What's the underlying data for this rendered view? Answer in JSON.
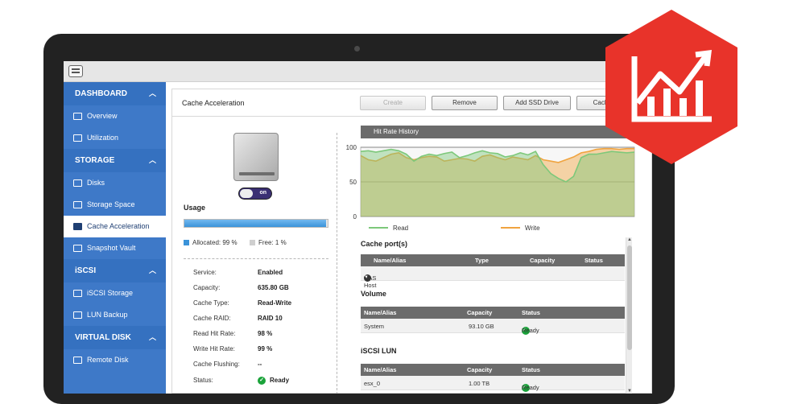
{
  "sidebar": {
    "sections": [
      {
        "label": "DASHBOARD",
        "items": [
          {
            "label": "Overview"
          },
          {
            "label": "Utilization"
          }
        ]
      },
      {
        "label": "STORAGE",
        "items": [
          {
            "label": "Disks"
          },
          {
            "label": "Storage Space"
          },
          {
            "label": "Cache Acceleration"
          },
          {
            "label": "Snapshot Vault"
          }
        ]
      },
      {
        "label": "iSCSI",
        "items": [
          {
            "label": "iSCSI Storage"
          },
          {
            "label": "LUN Backup"
          }
        ]
      },
      {
        "label": "VIRTUAL DISK",
        "items": [
          {
            "label": "Remote Disk"
          }
        ]
      }
    ]
  },
  "header": {
    "title": "Cache Acceleration",
    "buttons": {
      "create": "Create",
      "remove": "Remove",
      "add_ssd": "Add SSD Drive",
      "cache": "Cach"
    }
  },
  "left": {
    "toggle_label": "on",
    "usage_label": "Usage",
    "usage_percent": 99,
    "allocated_label": "Allocated: 99 %",
    "free_label": "Free: 1 %",
    "info": [
      {
        "key": "Service:",
        "value": "Enabled"
      },
      {
        "key": "Capacity:",
        "value": "635.80 GB"
      },
      {
        "key": "Cache Type:",
        "value": "Read-Write"
      },
      {
        "key": "Cache RAID:",
        "value": "RAID 10"
      },
      {
        "key": "Read Hit Rate:",
        "value": "98 %"
      },
      {
        "key": "Write Hit Rate:",
        "value": "99 %"
      },
      {
        "key": "Cache Flushing:",
        "value": "--"
      },
      {
        "key": "Status:",
        "value": "Ready"
      }
    ]
  },
  "chart": {
    "title": "Hit Rate History",
    "legend_read": "Read",
    "legend_write": "Write"
  },
  "chart_data": {
    "type": "area",
    "title": "Hit Rate History",
    "ylim": [
      0,
      100
    ],
    "yticks": [
      0,
      50,
      100
    ],
    "colors": {
      "read": "#7dc87a",
      "write": "#f0a440"
    },
    "series": [
      {
        "name": "Read",
        "values": [
          94,
          95,
          93,
          95,
          97,
          95,
          90,
          80,
          87,
          90,
          88,
          91,
          93,
          85,
          88,
          92,
          95,
          92,
          91,
          86,
          88,
          92,
          89,
          94,
          75,
          62,
          55,
          50,
          58,
          85,
          90,
          90,
          92,
          94,
          93,
          92,
          93
        ]
      },
      {
        "name": "Write",
        "values": [
          88,
          82,
          80,
          85,
          90,
          92,
          85,
          82,
          85,
          87,
          86,
          80,
          82,
          84,
          83,
          80,
          87,
          89,
          85,
          82,
          86,
          84,
          82,
          88,
          82,
          80,
          78,
          82,
          86,
          92,
          94,
          97,
          98,
          98,
          97,
          98,
          98
        ]
      }
    ],
    "legend": "bottom"
  },
  "cache_ports": {
    "title": "Cache port(s)",
    "headers": [
      "Name/Alias",
      "Type",
      "Capacity",
      "Status"
    ],
    "rows": [
      {
        "name": "NAS Host"
      }
    ]
  },
  "volume": {
    "title": "Volume",
    "headers": [
      "Name/Alias",
      "Capacity",
      "Status"
    ],
    "rows": [
      {
        "name": "System",
        "capacity": "93.10 GB",
        "status": "Ready"
      }
    ]
  },
  "iscsi_lun": {
    "title": "iSCSI LUN",
    "headers": [
      "Name/Alias",
      "Capacity",
      "Status"
    ],
    "rows": [
      {
        "name": "esx_0",
        "capacity": "1.00 TB",
        "status": "Ready"
      }
    ]
  },
  "logo": {
    "color": "#e8332a",
    "icon": "chart-growth-icon"
  }
}
